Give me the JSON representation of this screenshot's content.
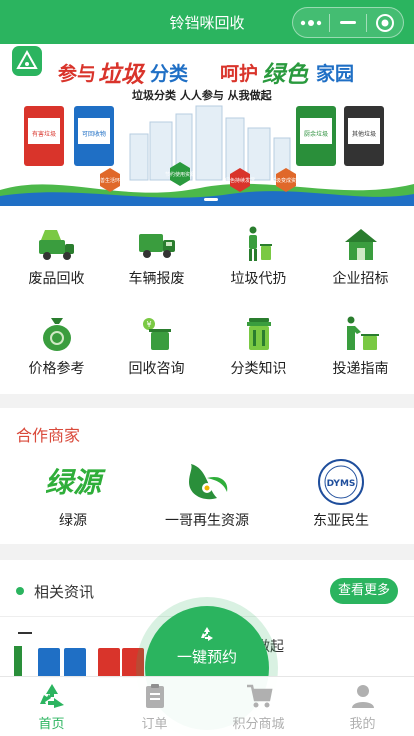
{
  "header": {
    "title": "铃铛咪回收",
    "more_icon": "ellipsis-icon",
    "minimize_icon": "minimize-icon",
    "close_icon": "target-close-icon"
  },
  "banner": {
    "headline_part1": "参与",
    "headline_part2": "垃圾",
    "headline_part3": "分类",
    "headline_part4": "呵护",
    "headline_part5": "绿色",
    "headline_part6": "家园",
    "subline": "垃圾分类 人人参与 从我做起",
    "bins": [
      {
        "label": "有害垃圾",
        "color": "#d9342b"
      },
      {
        "label": "可回收物",
        "color": "#1f6fc5"
      },
      {
        "label": "厨余垃圾",
        "color": "#2a8f3a"
      },
      {
        "label": "其他垃圾",
        "color": "#333333"
      }
    ],
    "hex_tags": [
      "改善生活环境",
      "节约使用资源",
      "绿色持续发展",
      "垃圾变成资源"
    ]
  },
  "services": [
    {
      "label": "废品回收",
      "icon": "recycle-truck-icon"
    },
    {
      "label": "车辆报废",
      "icon": "truck-icon"
    },
    {
      "label": "垃圾代扔",
      "icon": "person-trash-icon"
    },
    {
      "label": "企业招标",
      "icon": "house-icon"
    },
    {
      "label": "价格参考",
      "icon": "money-bag-icon"
    },
    {
      "label": "回收咨询",
      "icon": "bin-coin-icon"
    },
    {
      "label": "分类知识",
      "icon": "sorting-bin-icon"
    },
    {
      "label": "投递指南",
      "icon": "throw-trash-icon"
    }
  ],
  "partners": {
    "title": "合作商家",
    "items": [
      {
        "label": "绿源",
        "logo_text": "绿源"
      },
      {
        "label": "一哥再生资源",
        "logo_text": ""
      },
      {
        "label": "东亚民生",
        "logo_text": "DYMS"
      }
    ]
  },
  "news": {
    "title": "相关资讯",
    "more_label": "查看更多",
    "headline_fragment": "做起"
  },
  "fab": {
    "label": "一键预约",
    "icon": "recycle-icon"
  },
  "tabs": [
    {
      "label": "首页",
      "icon": "recycle-icon",
      "active": true
    },
    {
      "label": "订单",
      "icon": "clipboard-icon",
      "active": false
    },
    {
      "label": "积分商城",
      "icon": "cart-icon",
      "active": false
    },
    {
      "label": "我的",
      "icon": "user-icon",
      "active": false
    }
  ],
  "colors": {
    "primary": "#2bb45f",
    "accent_red": "#d94a3b",
    "inactive": "#b0b0b0"
  }
}
